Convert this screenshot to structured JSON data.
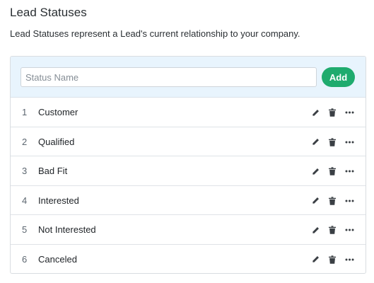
{
  "header": {
    "title": "Lead Statuses",
    "description": "Lead Statuses represent a Lead's current relationship to your company."
  },
  "add_form": {
    "input_placeholder": "Status Name",
    "input_value": "",
    "add_label": "Add"
  },
  "statuses": [
    {
      "num": "1",
      "label": "Customer"
    },
    {
      "num": "2",
      "label": "Qualified"
    },
    {
      "num": "3",
      "label": "Bad Fit"
    },
    {
      "num": "4",
      "label": "Interested"
    },
    {
      "num": "5",
      "label": "Not Interested"
    },
    {
      "num": "6",
      "label": "Canceled"
    }
  ],
  "row_icons": [
    "pencil-icon",
    "trash-icon",
    "more-dots-icon"
  ],
  "colors": {
    "accent": "#1fab6e",
    "add_bar_bg": "#e8f4fd"
  }
}
